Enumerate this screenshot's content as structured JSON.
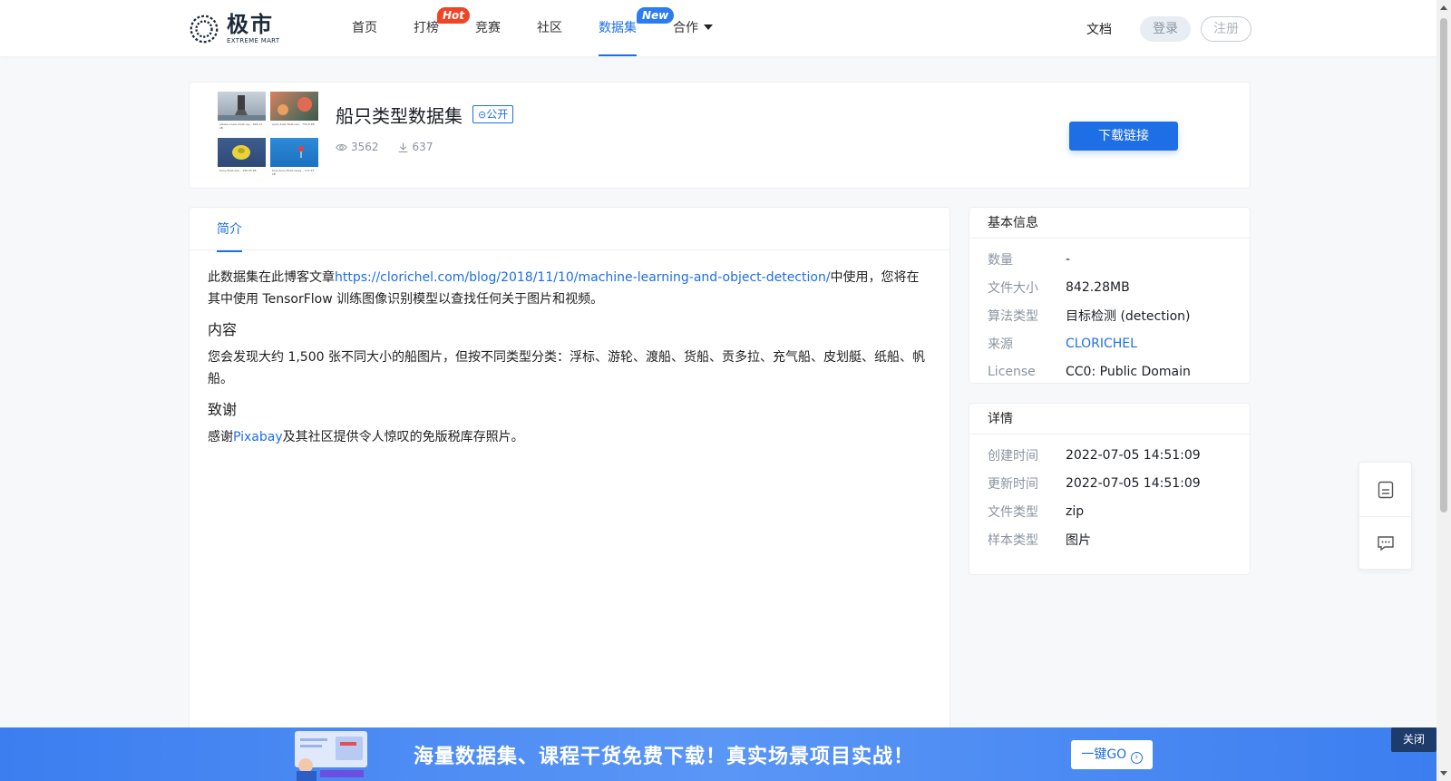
{
  "header": {
    "logo_cn": "极市",
    "logo_en": "EXTREME MART",
    "nav": [
      {
        "label": "首页"
      },
      {
        "label": "打榜",
        "badge": "Hot"
      },
      {
        "label": "竞赛"
      },
      {
        "label": "社区"
      },
      {
        "label": "数据集",
        "badge": "New",
        "active": true
      },
      {
        "label": "合作"
      }
    ],
    "docs": "文档",
    "login": "登录",
    "register": "注册"
  },
  "dataset": {
    "title": "船只类型数据集",
    "visibility": "公开",
    "views": "3562",
    "downloads": "637",
    "download_button": "下载链接",
    "thumbnails": [
      {
        "caption": "alaska-ocean-boat-rig... 168.13 kB"
      },
      {
        "caption": "sport-boat-float-red... 750.8 kB"
      },
      {
        "caption": "buoy-float-sea... 156.55 kB"
      },
      {
        "caption": "blue-buoy-float-navig... 172.15 kB"
      }
    ]
  },
  "intro": {
    "tab": "简介",
    "p1_before": "此数据集在此博客文章",
    "p1_link": "https://clorichel.com/blog/2018/11/10/machine-learning-and-object-detection/",
    "p1_after": "中使用，您将在其中使用 TensorFlow 训练图像识别模型以查找任何关于图片和视频。",
    "h_content": "内容",
    "p2": "您会发现大约 1,500 张不同大小的船图片，但按不同类型分类：浮标、游轮、渡船、货船、贡多拉、充气船、皮划艇、纸船、帆船。",
    "h_thanks": "致谢",
    "p3_before": "感谢",
    "p3_link": "Pixabay",
    "p3_after": "及其社区提供令人惊叹的免版税库存照片。"
  },
  "basic_info": {
    "title": "基本信息",
    "rows": [
      {
        "key": "数量",
        "value": "-"
      },
      {
        "key": "文件大小",
        "value": "842.28MB"
      },
      {
        "key": "算法类型",
        "value": "目标检测 (detection)"
      },
      {
        "key": "来源",
        "value": "CLORICHEL"
      },
      {
        "key": "License",
        "value": "CC0: Public Domain"
      }
    ]
  },
  "details": {
    "title": "详情",
    "rows": [
      {
        "key": "创建时间",
        "value": "2022-07-05 14:51:09"
      },
      {
        "key": "更新时间",
        "value": "2022-07-05 14:51:09"
      },
      {
        "key": "文件类型",
        "value": "zip"
      },
      {
        "key": "样本类型",
        "value": "图片"
      }
    ]
  },
  "banner": {
    "text": "海量数据集、课程干货免费下载！真实场景项目实战！",
    "button": "一键GO",
    "close": "关闭"
  },
  "colors": {
    "accent": "#1e6fe6",
    "hot": "#f04424",
    "banner": "#4a8bf3"
  }
}
